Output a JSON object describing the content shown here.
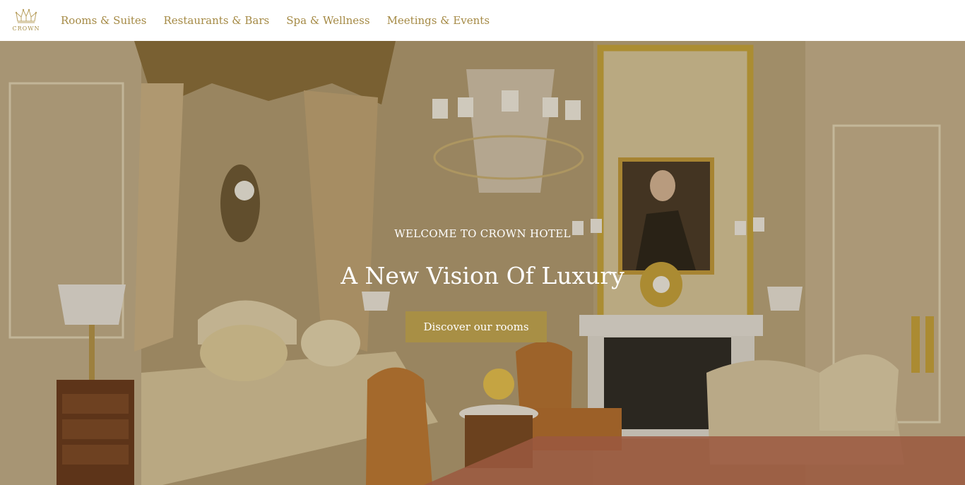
{
  "brand": {
    "name": "CROWN",
    "color": "#a8904a",
    "logo_icon": "crown-icon"
  },
  "nav": {
    "items": [
      {
        "label": "Rooms & Suites"
      },
      {
        "label": "Restaurants & Bars"
      },
      {
        "label": "Spa & Wellness"
      },
      {
        "label": "Meetings & Events"
      }
    ]
  },
  "hero": {
    "eyebrow": "WELCOME TO CROWN HOTEL",
    "title": "A New Vision Of Luxury",
    "cta_label": "Discover our rooms",
    "cta_color": "#a88f45",
    "image_subject": "ornate-hotel-bedroom-photo"
  }
}
